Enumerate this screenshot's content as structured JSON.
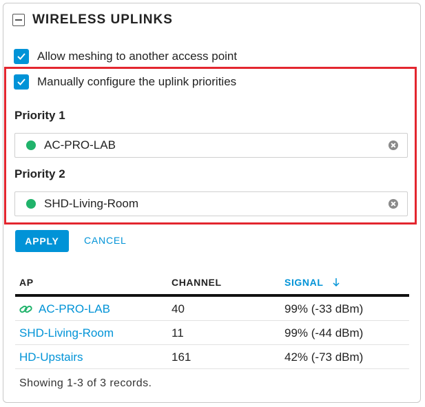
{
  "section": {
    "title": "WIRELESS UPLINKS"
  },
  "options": {
    "allow_meshing": {
      "label": "Allow meshing to another access point",
      "checked": true
    },
    "manual_priorities": {
      "label": "Manually configure the uplink priorities",
      "checked": true
    }
  },
  "priorities": [
    {
      "label": "Priority 1",
      "value": "AC-PRO-LAB",
      "status_color": "#20b36b"
    },
    {
      "label": "Priority 2",
      "value": "SHD-Living-Room",
      "status_color": "#20b36b"
    }
  ],
  "actions": {
    "apply_label": "APPLY",
    "cancel_label": "CANCEL"
  },
  "table": {
    "columns": {
      "ap": "AP",
      "channel": "CHANNEL",
      "signal": "SIGNAL",
      "sort_icon": "arrow-down-icon"
    },
    "rows": [
      {
        "ap": "AC-PRO-LAB",
        "channel": "40",
        "signal": "99% (-33 dBm)",
        "uplink_icon": "link-icon"
      },
      {
        "ap": "SHD-Living-Room",
        "channel": "11",
        "signal": "99% (-44 dBm)"
      },
      {
        "ap": "HD-Upstairs",
        "channel": "161",
        "signal": "42% (-73 dBm)"
      }
    ],
    "footer": "Showing 1-3 of 3 records."
  },
  "colors": {
    "accent": "#0193d7",
    "highlight": "#e3262f",
    "online": "#20b36b"
  }
}
